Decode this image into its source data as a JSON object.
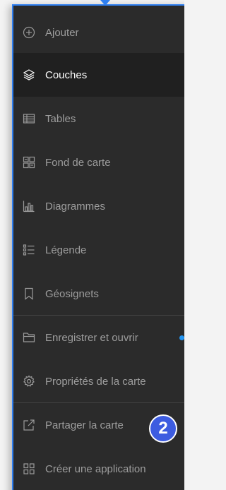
{
  "menu": {
    "items": [
      {
        "label": "Ajouter",
        "icon": "plus-circle-icon"
      },
      {
        "label": "Couches",
        "icon": "layers-icon",
        "active": true
      },
      {
        "label": "Tables",
        "icon": "table-icon"
      },
      {
        "label": "Fond de carte",
        "icon": "basemap-icon"
      },
      {
        "label": "Diagrammes",
        "icon": "chart-icon"
      },
      {
        "label": "Légende",
        "icon": "legend-icon"
      },
      {
        "label": "Géosignets",
        "icon": "bookmark-icon"
      },
      {
        "label": "Enregistrer et ouvrir",
        "icon": "folder-icon"
      },
      {
        "label": "Propriétés de la carte",
        "icon": "gear-icon"
      },
      {
        "label": "Partager la carte",
        "icon": "share-icon"
      },
      {
        "label": "Créer une application",
        "icon": "apps-grid-icon"
      }
    ]
  },
  "badge": {
    "text": "2"
  },
  "colors": {
    "panel_bg": "#2b2b2b",
    "active_bg": "#202020",
    "accent": "#2f7ff0",
    "badge": "#3d5ce0"
  }
}
